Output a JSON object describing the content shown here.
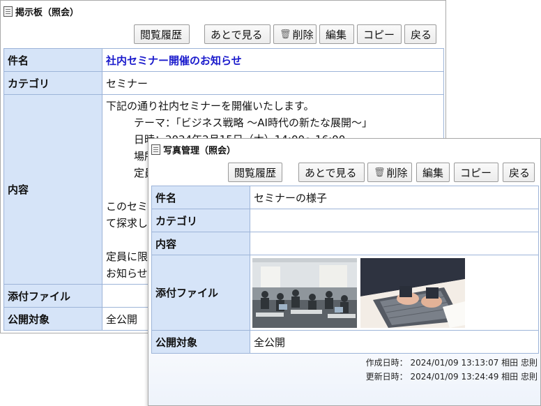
{
  "back_window": {
    "title": "掲示板（照会）",
    "buttons": {
      "history": "閲覧履歴",
      "later": "あとで見る",
      "delete": "削除",
      "edit": "編集",
      "copy": "コピー",
      "back": "戻る"
    },
    "labels": {
      "subject": "件名",
      "category": "カテゴリ",
      "content": "内容",
      "attachment": "添付ファイル",
      "visibility": "公開対象"
    },
    "values": {
      "subject": "社内セミナー開催のお知らせ",
      "category": "セミナー",
      "content_lines": [
        "下記の通り社内セミナーを開催いたします。",
        "テーマ：「ビジネス戦略 ～AI時代の新たな展開～」",
        "日時：2024年2月15日（木）14:00～16:00",
        "場所",
        "定員",
        "",
        "このセミ",
        "て探求し",
        "",
        "定員に限",
        "お知らせ"
      ],
      "attachment": "",
      "visibility": "全公開"
    }
  },
  "front_window": {
    "title": "写真管理（照会）",
    "buttons": {
      "history": "閲覧履歴",
      "later": "あとで見る",
      "delete": "削除",
      "edit": "編集",
      "copy": "コピー",
      "back": "戻る"
    },
    "labels": {
      "subject": "件名",
      "category": "カテゴリ",
      "content": "内容",
      "attachment": "添付ファイル",
      "visibility": "公開対象"
    },
    "values": {
      "subject": "セミナーの様子",
      "category": "",
      "content": "",
      "visibility": "全公開"
    },
    "meta": {
      "created": "作成日時： 2024/01/09 13:13:07 相田 忠則",
      "updated": "更新日時： 2024/01/09 13:24:49 相田 忠則"
    }
  },
  "colors": {
    "label_bg": "#d6e4f8",
    "border": "#9db4d8",
    "link": "#1a1acc"
  },
  "icons": [
    "document-icon",
    "trash-icon"
  ]
}
